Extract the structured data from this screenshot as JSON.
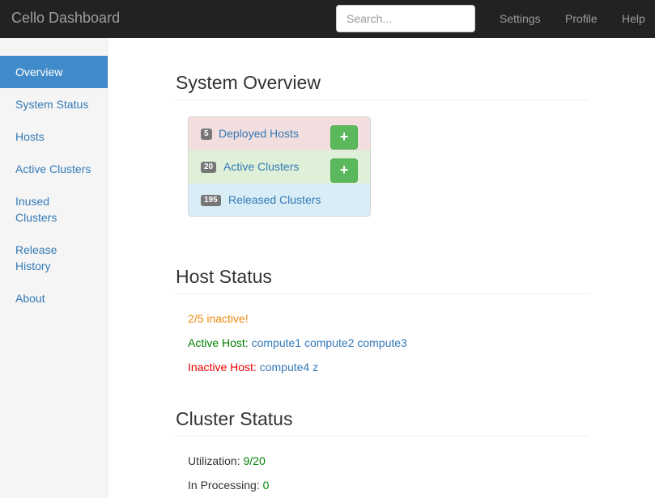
{
  "navbar": {
    "brand": "Cello Dashboard",
    "search_placeholder": "Search...",
    "links": [
      "Settings",
      "Profile",
      "Help"
    ]
  },
  "sidebar": {
    "items": [
      {
        "label": "Overview",
        "active": true
      },
      {
        "label": "System Status",
        "active": false
      },
      {
        "label": "Hosts",
        "active": false
      },
      {
        "label": "Active Clusters",
        "active": false
      },
      {
        "label": "Inused Clusters",
        "active": false
      },
      {
        "label": "Release History",
        "active": false
      },
      {
        "label": "About",
        "active": false
      }
    ]
  },
  "overview": {
    "title": "System Overview",
    "rows": [
      {
        "count": "5",
        "label": "Deployed Hosts",
        "has_add": true,
        "add_icon": "+"
      },
      {
        "count": "20",
        "label": "Active Clusters",
        "has_add": true,
        "add_icon": "+"
      },
      {
        "count": "195",
        "label": "Released Clusters",
        "has_add": false
      }
    ]
  },
  "host_status": {
    "title": "Host Status",
    "summary": "2/5 inactive!",
    "active_label": "Active Host:",
    "active_hosts": [
      "compute1",
      "compute2",
      "compute3"
    ],
    "inactive_label": "Inactive Host:",
    "inactive_hosts": [
      "compute4",
      "z"
    ]
  },
  "cluster_status": {
    "title": "Cluster Status",
    "utilization_label": "Utilization:",
    "utilization_value": "9/20",
    "processing_label": "In Processing:",
    "processing_value": "0"
  },
  "colors": {
    "navbar_bg": "#222222",
    "active_nav": "#428bca",
    "link": "#337ab7",
    "success": "#5cb85c",
    "warning": "#f0890f"
  }
}
